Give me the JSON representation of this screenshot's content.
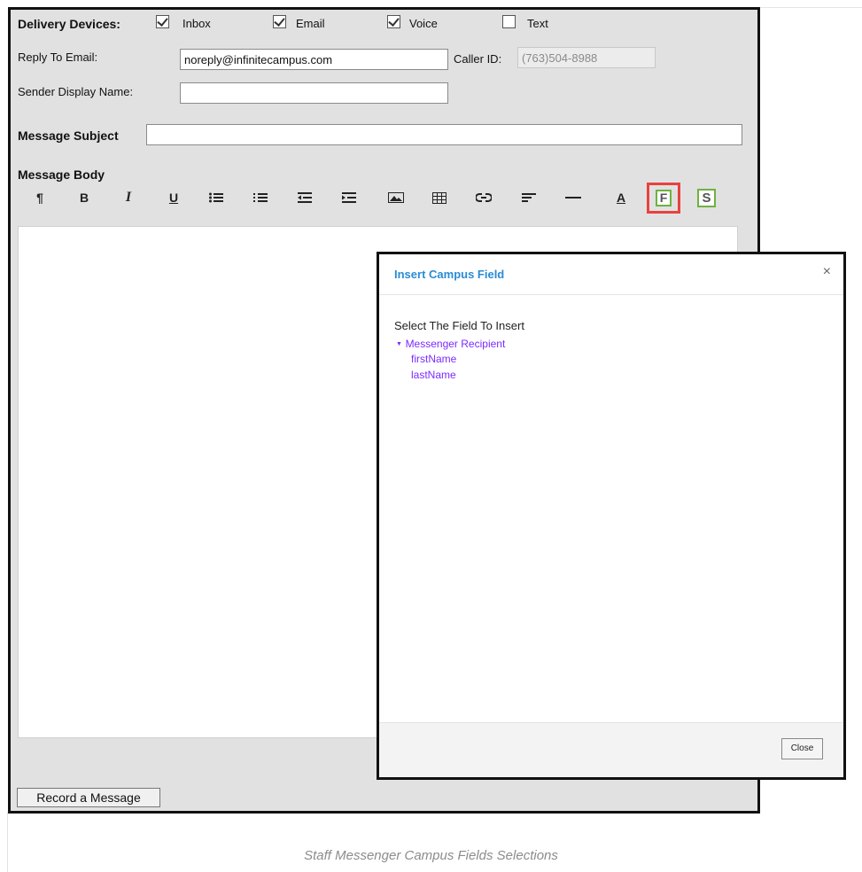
{
  "delivery": {
    "label": "Delivery Devices:",
    "options": [
      {
        "label": "Inbox",
        "checked": true
      },
      {
        "label": "Email",
        "checked": true
      },
      {
        "label": "Voice",
        "checked": true
      },
      {
        "label": "Text",
        "checked": false
      }
    ]
  },
  "reply": {
    "label": "Reply To Email:",
    "value": "noreply@infinitecampus.com"
  },
  "caller": {
    "label": "Caller ID:",
    "value": "(763)504-8988"
  },
  "sender": {
    "label": "Sender Display Name:",
    "value": ""
  },
  "subject": {
    "label": "Message Subject",
    "value": ""
  },
  "body": {
    "label": "Message Body"
  },
  "toolbar": {
    "paragraph": "¶",
    "bold": "B",
    "italic": "I",
    "underline": "U",
    "font_color": "A",
    "campus_field": "F",
    "staff_field": "S",
    "icons": [
      "paragraph-icon",
      "bold-icon",
      "italic-icon",
      "underline-icon",
      "bullet-list-icon",
      "numbered-list-icon",
      "outdent-icon",
      "indent-icon",
      "image-icon",
      "table-icon",
      "link-icon",
      "align-icon",
      "horizontal-rule-icon",
      "font-color-icon",
      "campus-field-icon",
      "staff-field-icon"
    ],
    "highlight_color": "#e8413f",
    "field_icon_color": "#6db33f"
  },
  "record_button": "Record a Message",
  "dialog": {
    "title": "Insert Campus Field",
    "prompt": "Select The Field To Insert",
    "tree": {
      "root": "Messenger Recipient",
      "children": [
        "firstName",
        "lastName"
      ]
    },
    "close_label": "Close",
    "x_label": "×"
  },
  "caption": "Staff Messenger Campus Fields Selections"
}
